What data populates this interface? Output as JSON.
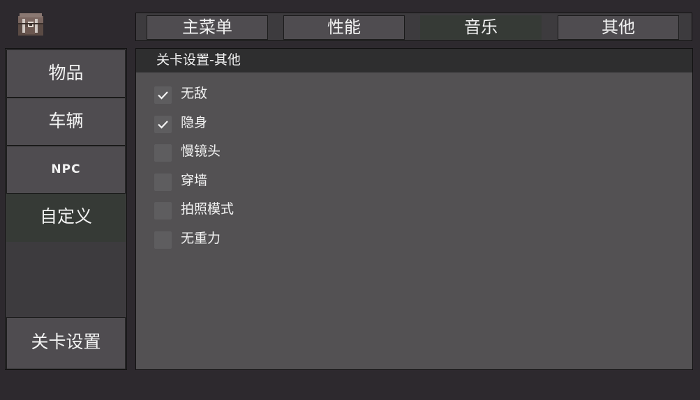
{
  "app": {
    "logo_icon": "treasure-chest-icon"
  },
  "tabs": [
    {
      "label": "主菜单",
      "active": false
    },
    {
      "label": "性能",
      "active": false
    },
    {
      "label": "音乐",
      "active": true
    },
    {
      "label": "其他",
      "active": false
    }
  ],
  "sidebar": {
    "items": [
      {
        "label": "物品",
        "active": false
      },
      {
        "label": "车辆",
        "active": false
      },
      {
        "label": "NPC",
        "active": false
      },
      {
        "label": "自定义",
        "active": true
      }
    ],
    "bottom_label": "关卡设置"
  },
  "panel": {
    "title": "关卡设置-其他",
    "options": [
      {
        "label": "无敌",
        "checked": true
      },
      {
        "label": "隐身",
        "checked": true
      },
      {
        "label": "慢镜头",
        "checked": false
      },
      {
        "label": "穿墙",
        "checked": false
      },
      {
        "label": "拍照模式",
        "checked": false
      },
      {
        "label": "无重力",
        "checked": false
      }
    ]
  },
  "colors": {
    "background": "#2d292e",
    "button": "#4f4c50",
    "button_active": "#363a36",
    "panel": "#535153",
    "panel_header": "#2e2e2f",
    "checkbox": "#5e5d5f"
  }
}
